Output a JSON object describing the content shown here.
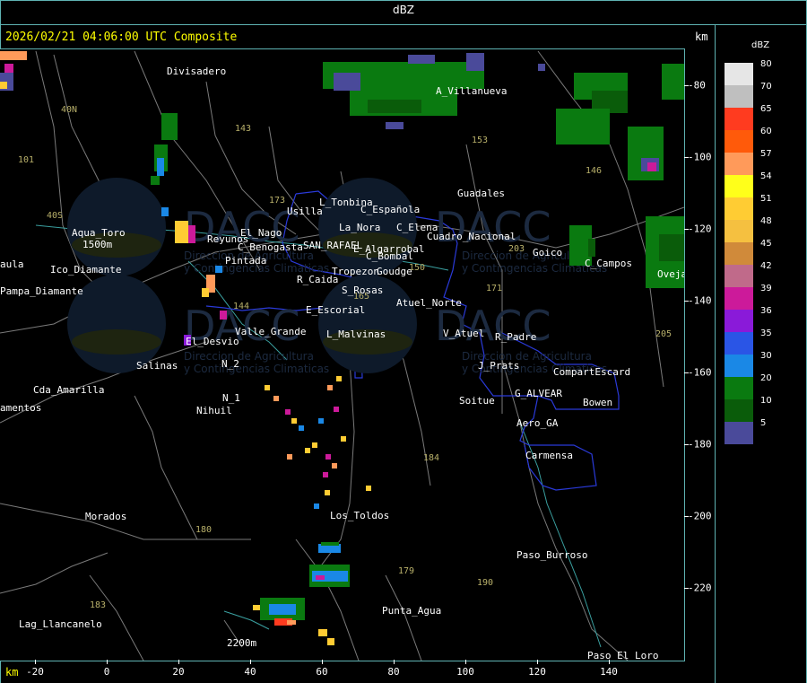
{
  "header": {
    "units_title": "dBZ",
    "timestamp": "2026/02/21 04:06:00 UTC Composite",
    "km_top": "km",
    "km_bottom": "km"
  },
  "x_axis": {
    "ticks": [
      {
        "label": "-20",
        "value": -20
      },
      {
        "label": "0",
        "value": 0
      },
      {
        "label": "20",
        "value": 20
      },
      {
        "label": "40",
        "value": 40
      },
      {
        "label": "60",
        "value": 60
      },
      {
        "label": "80",
        "value": 80
      },
      {
        "label": "100",
        "value": 100
      },
      {
        "label": "120",
        "value": 120
      },
      {
        "label": "140",
        "value": 140
      }
    ]
  },
  "y_axis": {
    "ticks": [
      {
        "label": "-80",
        "value": -80
      },
      {
        "label": "-100",
        "value": -100
      },
      {
        "label": "-120",
        "value": -120
      },
      {
        "label": "-140",
        "value": -140
      },
      {
        "label": "-160",
        "value": -160
      },
      {
        "label": "-180",
        "value": -180
      },
      {
        "label": "-200",
        "value": -200
      },
      {
        "label": "-220",
        "value": -220
      }
    ]
  },
  "legend": {
    "title": "dBZ",
    "entries": [
      {
        "label": "80",
        "color": "#e6e6e6"
      },
      {
        "label": "70",
        "color": "#bfbfbf"
      },
      {
        "label": "65",
        "color": "#ff3b1f"
      },
      {
        "label": "60",
        "color": "#ff5a0a"
      },
      {
        "label": "57",
        "color": "#ff9a5a"
      },
      {
        "label": "54",
        "color": "#ffff1a"
      },
      {
        "label": "51",
        "color": "#ffcc33"
      },
      {
        "label": "48",
        "color": "#f5c040"
      },
      {
        "label": "45",
        "color": "#d08a3a"
      },
      {
        "label": "42",
        "color": "#c06a8a"
      },
      {
        "label": "39",
        "color": "#cc1a9a"
      },
      {
        "label": "36",
        "color": "#8a1ad9"
      },
      {
        "label": "35",
        "color": "#2a55e6"
      },
      {
        "label": "30",
        "color": "#1a88e6"
      },
      {
        "label": "20",
        "color": "#0a7a10"
      },
      {
        "label": "10",
        "color": "#0a5c0a"
      },
      {
        "label": "5",
        "color": "#4a4a9a"
      }
    ]
  },
  "places": [
    {
      "name": "Divisadero"
    },
    {
      "name": "A_Villanueva"
    },
    {
      "name": "Guadales"
    },
    {
      "name": "L_Tonbina"
    },
    {
      "name": "Usilla"
    },
    {
      "name": "C_Española"
    },
    {
      "name": "C_Elena"
    },
    {
      "name": "Cuadro_Nacional"
    },
    {
      "name": "La_Nora"
    },
    {
      "name": "Aqua_Toro"
    },
    {
      "name": "Pampa_Diamante"
    },
    {
      "name": "Reyunos"
    },
    {
      "name": "El_Nago"
    },
    {
      "name": "C_Benogasta"
    },
    {
      "name": "SAN_RAFAEL"
    },
    {
      "name": "E_Algarrobal"
    },
    {
      "name": "C_Bombal"
    },
    {
      "name": "Goico"
    },
    {
      "name": "C_Campos"
    },
    {
      "name": "Oveja"
    },
    {
      "name": "Pintada"
    },
    {
      "name": "R_Caida"
    },
    {
      "name": "Tropezon"
    },
    {
      "name": "Goudge"
    },
    {
      "name": "S_Rosas"
    },
    {
      "name": "Atuel_Norte"
    },
    {
      "name": "E_Escorial"
    },
    {
      "name": "Valle_Grande"
    },
    {
      "name": "L_Malvinas"
    },
    {
      "name": "V_Atuel"
    },
    {
      "name": "R_Padre"
    },
    {
      "name": "El_Desvio"
    },
    {
      "name": "Salinas"
    },
    {
      "name": "N_2"
    },
    {
      "name": "N_1"
    },
    {
      "name": "Nihuil"
    },
    {
      "name": "J_Prats"
    },
    {
      "name": "CompartEscard"
    },
    {
      "name": "G_ALVEAR"
    },
    {
      "name": "Soitue"
    },
    {
      "name": "Bowen"
    },
    {
      "name": "Aero_GA"
    },
    {
      "name": "Carmensa"
    },
    {
      "name": "Cda_Amarilla"
    },
    {
      "name": "amentos"
    },
    {
      "name": "Morados"
    },
    {
      "name": "Los_Toldos"
    },
    {
      "name": "Paso_Burroso"
    },
    {
      "name": "Punta_Agua"
    },
    {
      "name": "Lag_Llancanelo"
    },
    {
      "name": "Paso_El_Loro"
    },
    {
      "name": "aula"
    },
    {
      "name": "Ico_Diamante"
    },
    {
      "name": "1500m"
    },
    {
      "name": "2200m"
    }
  ],
  "routes": [
    {
      "label": "143"
    },
    {
      "label": "153"
    },
    {
      "label": "146"
    },
    {
      "label": "101"
    },
    {
      "label": "40N"
    },
    {
      "label": "40S"
    },
    {
      "label": "150"
    },
    {
      "label": "173"
    },
    {
      "label": "144"
    },
    {
      "label": "171"
    },
    {
      "label": "165"
    },
    {
      "label": "203"
    },
    {
      "label": "205"
    },
    {
      "label": "184"
    },
    {
      "label": "180"
    },
    {
      "label": "179"
    },
    {
      "label": "190"
    },
    {
      "label": "183"
    }
  ],
  "watermark": {
    "brand": "DACC",
    "line1": "Direccion de Agricultura",
    "line2": "y Contingencias Climaticas"
  }
}
